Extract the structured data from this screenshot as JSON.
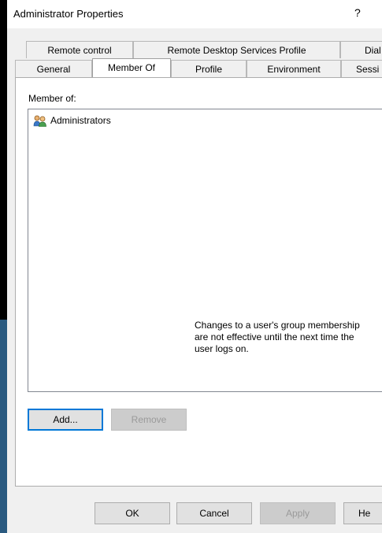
{
  "window": {
    "title": "Administrator Properties",
    "help": "?"
  },
  "tabs": {
    "row1": [
      "Remote control",
      "Remote Desktop Services Profile",
      "Dial"
    ],
    "row2": [
      "General",
      "Member Of",
      "Profile",
      "Environment",
      "Sessi"
    ],
    "selected": "Member Of"
  },
  "member_of": {
    "label": "Member of:",
    "items": [
      {
        "name": "Administrators",
        "icon": "group-icon"
      }
    ]
  },
  "buttons": {
    "add": "Add...",
    "remove": "Remove"
  },
  "note": {
    "line1": "Changes to a user's group membership",
    "line2": "are not effective until the next time the",
    "line3": "user logs on."
  },
  "footer": {
    "ok": "OK",
    "cancel": "Cancel",
    "apply": "Apply",
    "help": "He"
  },
  "colors": {
    "accent": "#0078d7",
    "dialog_bg": "#f0f0f0"
  }
}
